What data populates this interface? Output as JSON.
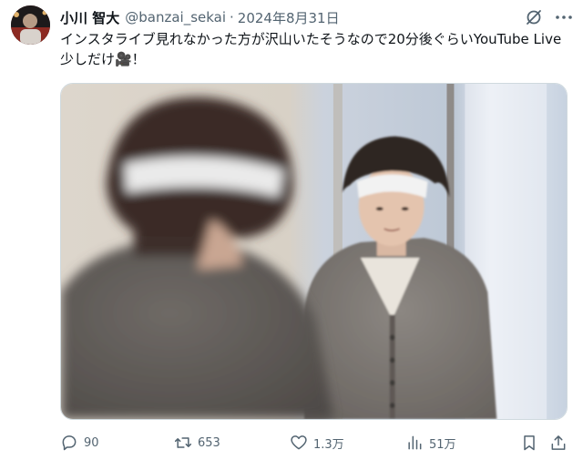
{
  "author": {
    "display_name": "小川 智大",
    "handle": "@banzai_sekai",
    "separator": "·",
    "date": "2024年8月31日"
  },
  "tweet": {
    "text": "インスタライブ見れなかった方が沢山いたそうなので20分後ぐらいYouTube Live少しだけ🎥！"
  },
  "actions": {
    "reply_count": "90",
    "retweet_count": "653",
    "like_count": "1.3万",
    "view_count": "51万"
  },
  "icons": {
    "grok": "grok-icon",
    "more": "more-icon",
    "reply": "reply-icon",
    "retweet": "retweet-icon",
    "like": "heart-icon",
    "views": "views-icon",
    "bookmark": "bookmark-icon",
    "share": "share-icon"
  },
  "colors": {
    "text": "#0f1419",
    "secondary": "#536471",
    "border": "#cfd9de"
  }
}
